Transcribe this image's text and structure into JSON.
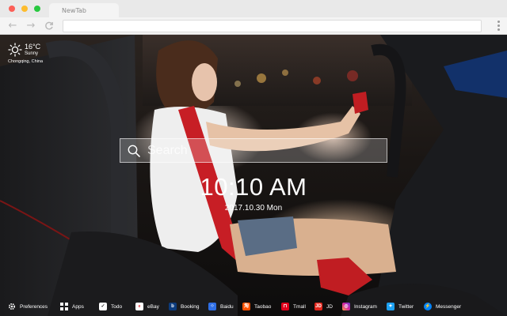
{
  "browser": {
    "tab_title": "NewTab",
    "back_glyph": "←",
    "forward_glyph": "→",
    "reload_glyph": "C"
  },
  "weather": {
    "temperature": "16°C",
    "condition": "Sunny",
    "location": "Chongqing, China",
    "icon": "sun-icon"
  },
  "search": {
    "placeholder": "Search"
  },
  "clock": {
    "time": "10:10 AM",
    "date": "2017.10.30 Mon"
  },
  "bottom_bar": {
    "items": [
      {
        "label": "Preferences",
        "icon": "gear-icon",
        "color": "#ffffff"
      },
      {
        "label": "Apps",
        "icon": "grid-icon",
        "color": "#ffffff"
      },
      {
        "label": "Todo",
        "icon": "checkbox-icon",
        "color": "#ffffff"
      },
      {
        "label": "eBay",
        "icon": "ebay-icon",
        "color": "#ffffff"
      },
      {
        "label": "Booking",
        "icon": "booking-icon",
        "color": "#0c3b7c"
      },
      {
        "label": "Baidu",
        "icon": "baidu-icon",
        "color": "#2f6fe5"
      },
      {
        "label": "Taobao",
        "icon": "taobao-icon",
        "color": "#ff5000"
      },
      {
        "label": "Tmall",
        "icon": "tmall-icon",
        "color": "#e0001b"
      },
      {
        "label": "JD",
        "icon": "jd-icon",
        "color": "#e1251b"
      },
      {
        "label": "Instagram",
        "icon": "instagram-icon",
        "color": "#d6249f"
      },
      {
        "label": "Twitter",
        "icon": "twitter-icon",
        "color": "#1da1f2"
      },
      {
        "label": "Messenger",
        "icon": "messenger-icon",
        "color": "#0084ff"
      }
    ]
  }
}
